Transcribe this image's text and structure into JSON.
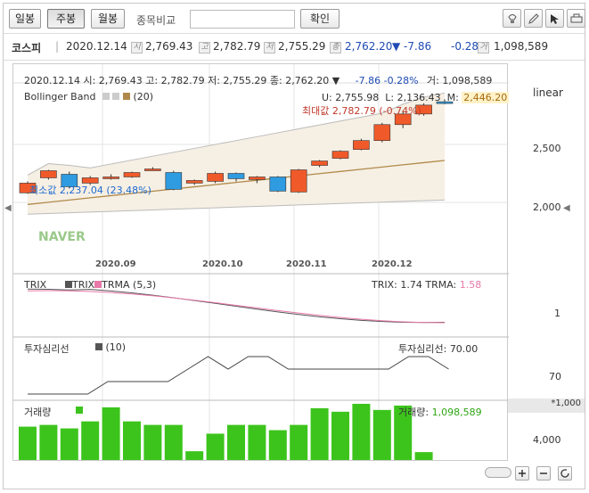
{
  "periods": [
    "일봉",
    "주봉",
    "월봉"
  ],
  "compare": {
    "label": "종목비교",
    "button": "확인",
    "value": ""
  },
  "info": {
    "name": "코스피",
    "date": "2020.12.14",
    "open_tag": "시",
    "open": "2,769.43",
    "high_tag": "고",
    "high": "2,782.79",
    "low_tag": "저",
    "low": "2,755.29",
    "close_tag": "종",
    "close": "2,762.20",
    "change": "▼ -7.86",
    "pct": "-0.28%",
    "vol_tag": "거",
    "volume": "1,098,589"
  },
  "legend": "2020.12.14 시: 2,769.43 고: 2,782.79 저: 2,755.29 종: 2,762.20 ▼",
  "legend_change": "-7.86  -0.28%",
  "legend_vol": "거: 1,098,589",
  "bollinger": {
    "label": "Bollinger Band",
    "period": "(20)",
    "u": "U: 2,755.98",
    "l": "L: 2,136.43",
    "m": "M:",
    "m_val": "2,446.20"
  },
  "max_label": "최대값 2,782.79 (-0.74%)",
  "min_label": "최소값 2,237.04 (23.48%)",
  "watermark": "NAVER",
  "scale_mode": "linear",
  "price_ticks": [
    "2,500",
    "2,000"
  ],
  "x_ticks": [
    "2020.09",
    "2020.10",
    "2020.11",
    "2020.12"
  ],
  "trix": {
    "label": "TRIX",
    "legend1": "TRIX",
    "legend2": "TRMA (5,3)",
    "value_label": "TRIX:",
    "value": "1.74",
    "trma_label": "TRMA:",
    "trma_value": "1.58",
    "tick": "1"
  },
  "psy": {
    "label": "투자심리선",
    "period": "(10)",
    "value_label": "투자심리선:",
    "value": "70.00",
    "tick": "70"
  },
  "vol": {
    "label": "거래량",
    "value_label": "거래량:",
    "value": "1,098,589",
    "unit": "*1,000",
    "tick": "4,000"
  },
  "colors": {
    "up": "#f05a2a",
    "down": "#2f9be0",
    "volume": "#3cc41c",
    "trix": "#555555",
    "trma": "#e879a8",
    "middle": "#b08a4a"
  },
  "chart_data": {
    "type": "candlestick",
    "candles": [
      {
        "o": 2255,
        "h": 2320,
        "l": 2250,
        "c": 2310
      },
      {
        "o": 2340,
        "h": 2385,
        "l": 2330,
        "c": 2380
      },
      {
        "o": 2360,
        "h": 2375,
        "l": 2280,
        "c": 2290
      },
      {
        "o": 2310,
        "h": 2350,
        "l": 2300,
        "c": 2340
      },
      {
        "o": 2345,
        "h": 2360,
        "l": 2330,
        "c": 2345
      },
      {
        "o": 2345,
        "h": 2375,
        "l": 2340,
        "c": 2370
      },
      {
        "o": 2390,
        "h": 2400,
        "l": 2385,
        "c": 2390
      },
      {
        "o": 2370,
        "h": 2380,
        "l": 2270,
        "c": 2275
      },
      {
        "o": 2310,
        "h": 2330,
        "l": 2300,
        "c": 2325
      },
      {
        "o": 2320,
        "h": 2375,
        "l": 2310,
        "c": 2365
      },
      {
        "o": 2365,
        "h": 2370,
        "l": 2320,
        "c": 2335
      },
      {
        "o": 2330,
        "h": 2350,
        "l": 2310,
        "c": 2345
      },
      {
        "o": 2345,
        "h": 2350,
        "l": 2260,
        "c": 2265
      },
      {
        "o": 2260,
        "h": 2390,
        "l": 2255,
        "c": 2385
      },
      {
        "o": 2410,
        "h": 2440,
        "l": 2400,
        "c": 2435
      },
      {
        "o": 2450,
        "h": 2495,
        "l": 2445,
        "c": 2490
      },
      {
        "o": 2500,
        "h": 2560,
        "l": 2495,
        "c": 2550
      },
      {
        "o": 2550,
        "h": 2650,
        "l": 2540,
        "c": 2640
      },
      {
        "o": 2640,
        "h": 2720,
        "l": 2620,
        "c": 2700
      },
      {
        "o": 2700,
        "h": 2760,
        "l": 2690,
        "c": 2750
      },
      {
        "o": 2769,
        "h": 2783,
        "l": 2755,
        "c": 2762
      }
    ],
    "volumes": [
      1900,
      2000,
      1800,
      2200,
      3000,
      2200,
      2000,
      2000,
      500,
      1500,
      2000,
      2000,
      1700,
      2000,
      2950,
      2750,
      3200,
      2850,
      3100,
      450
    ],
    "psy": [
      40,
      40,
      40,
      40,
      50,
      50,
      50,
      50,
      60,
      70,
      60,
      70,
      70,
      60,
      60,
      60,
      60,
      60,
      60,
      70,
      70,
      60
    ],
    "ylim": [
      1900,
      2850
    ]
  }
}
